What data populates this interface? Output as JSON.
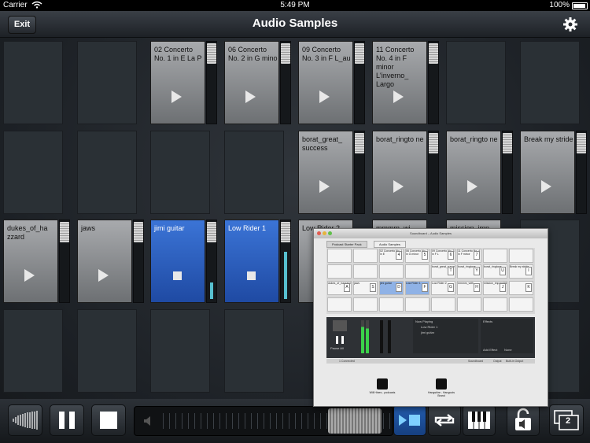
{
  "status": {
    "carrier": "Carrier",
    "time": "5:49 PM",
    "battery": "100%"
  },
  "nav": {
    "title": "Audio Samples",
    "exit_label": "Exit"
  },
  "grid": {
    "row1": {
      "c3": {
        "label": "02 Concerto No. 1 in E La P"
      },
      "c4": {
        "label": "06 Concerto No. 2 in G mino"
      },
      "c5": {
        "label": "09 Concerto No. 3 in F L_au"
      },
      "c6": {
        "label": "11 Concerto No. 4 in F minor L'inverno_ Largo"
      }
    },
    "row2": {
      "c5": {
        "label": "borat_great_ success"
      },
      "c6": {
        "label": "borat_ringto ne"
      },
      "c7": {
        "label": "borat_ringto ne"
      },
      "c8": {
        "label": "Break my stride"
      }
    },
    "row3": {
      "c1": {
        "label": "dukes_of_ha zzard"
      },
      "c2": {
        "label": "jaws"
      },
      "c3": {
        "label": "jimi guitar",
        "level": 0.22
      },
      "c4": {
        "label": "Low Rider 1",
        "level": 0.62
      },
      "c5": {
        "label": "Low Rider 2"
      },
      "c6": {
        "label": "mmmm_wi"
      },
      "c7": {
        "label": "mission_imp"
      }
    }
  },
  "overlay": {
    "title": "Soundboard – Audio Samples",
    "tabs": [
      "Podcast Starter Pack",
      "Audio Samples"
    ],
    "cells": [
      {
        "label": "02 Concerto No. 1 in E",
        "key": "4"
      },
      {
        "label": "06 Concerto No. 2 in G minor",
        "key": "5"
      },
      {
        "label": "09 Concerto No. 3 in F L",
        "key": "6"
      },
      {
        "label": "11 Concerto No. 4 in F minor",
        "key": "7"
      },
      {
        "label": "borat_great_success",
        "key": "T"
      },
      {
        "label": "borat_ringtone",
        "key": "Y"
      },
      {
        "label": "borat_ringtone",
        "key": "U"
      },
      {
        "label": "Break my stride",
        "key": "I"
      },
      {
        "label": "dukes_of_hazzard",
        "key": "A"
      },
      {
        "label": "jaws",
        "key": "S"
      },
      {
        "label": "jimi guitar",
        "key": "D"
      },
      {
        "label": "Low Rider 1",
        "key": "F"
      },
      {
        "label": "Low Rider 2",
        "key": "G"
      },
      {
        "label": "mmmm_with",
        "key": "H"
      },
      {
        "label": "mission_impossible",
        "key": "J"
      },
      {
        "label": "",
        "key": "K"
      }
    ],
    "now_playing_title": "Now Playing",
    "now_playing": [
      "Low Rider 1",
      "jimi guitar"
    ],
    "effects_title": "Effects",
    "pause_all": "Pause All",
    "add_effect": "Add Effect",
    "none": "None",
    "footer_left": "1 Connected",
    "footer_right": "Soundboard",
    "output": "Output",
    "output_value": "Built-in Output",
    "desktop": [
      {
        "label": "Will Hines - podcasts"
      },
      {
        "label": "Hangshire - Hangouts Brand"
      }
    ]
  },
  "toolbar": {
    "screens": "2"
  }
}
